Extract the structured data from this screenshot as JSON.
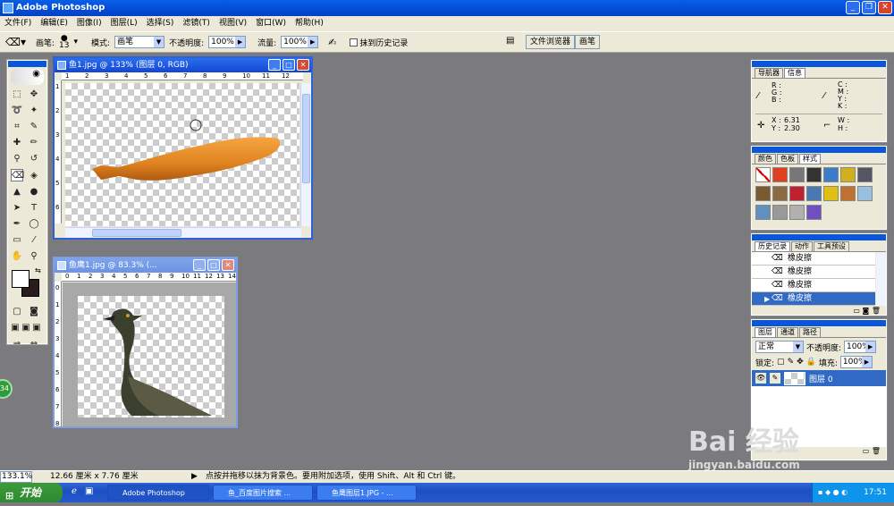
{
  "app": {
    "title": "Adobe Photoshop"
  },
  "menu": [
    "文件(F)",
    "编辑(E)",
    "图像(I)",
    "图层(L)",
    "选择(S)",
    "滤镜(T)",
    "视图(V)",
    "窗口(W)",
    "帮助(H)"
  ],
  "options": {
    "brush_label": "画笔:",
    "brush_size": "13",
    "mode_label": "模式:",
    "mode_value": "画笔",
    "opacity_label": "不透明度:",
    "opacity_value": "100%",
    "flow_label": "流量:",
    "flow_value": "100%",
    "erase_history_label": "抹到历史记录",
    "well_tabs": [
      "文件浏览器",
      "画笔"
    ]
  },
  "doc1": {
    "title": "鱼1.jpg @ 133% (图层 0, RGB)",
    "ruler_top": [
      "1",
      "2",
      "3",
      "4",
      "5",
      "6",
      "7",
      "8",
      "9",
      "10",
      "11",
      "12"
    ],
    "ruler_left": [
      "1",
      "2",
      "3",
      "4",
      "5",
      "6"
    ]
  },
  "doc2": {
    "title": "鱼鹰1.jpg @ 83.3% (...",
    "ruler_top": [
      "0",
      "1",
      "2",
      "3",
      "4",
      "5",
      "6",
      "7",
      "8",
      "9",
      "10",
      "11",
      "12",
      "13",
      "14"
    ],
    "ruler_left": [
      "0",
      "1",
      "2",
      "3",
      "4",
      "5",
      "6",
      "7",
      "8"
    ]
  },
  "navigator": {
    "tabs": [
      "导航器",
      "信息"
    ],
    "rgb": "R :\nG :\nB :",
    "cmyk": "C :\nM :\nY :\nK :",
    "x_label": "X :",
    "x_value": "6.31",
    "y_label": "Y :",
    "y_value": "2.30",
    "wh": "W :\nH :"
  },
  "color_panel": {
    "tabs": [
      "颜色",
      "色板",
      "样式"
    ]
  },
  "history": {
    "tabs": [
      "历史记录",
      "动作",
      "工具预设"
    ],
    "items": [
      "橡皮擦",
      "橡皮擦",
      "橡皮擦",
      "橡皮擦"
    ]
  },
  "layers": {
    "tabs": [
      "图层",
      "通道",
      "路径"
    ],
    "blend": "正常",
    "opacity_label": "不透明度:",
    "opacity_value": "100%",
    "lock_label": "锁定:",
    "fill_label": "填充:",
    "fill_value": "100%",
    "layer_name": "图层 0"
  },
  "status": {
    "zoom": "133.1%",
    "size": "12.66 厘米 x 7.76 厘米",
    "hint": "点按并拖移以抹为背景色。要用附加选项，使用 Shift、Alt 和 Ctrl 键。"
  },
  "taskbar": {
    "start": "开始",
    "tasks": [
      "Adobe Photoshop",
      "鱼_百度图片搜索 ...",
      "鱼鹰图层1.JPG - ..."
    ],
    "time": "17:51"
  },
  "side_badge": "34",
  "watermark": {
    "logo": "Bai 经验",
    "url": "jingyan.baidu.com"
  },
  "colors": {
    "xp_blue": "#0a5ee8",
    "selection": "#316ac5",
    "workspace": "#7b7a7e"
  }
}
